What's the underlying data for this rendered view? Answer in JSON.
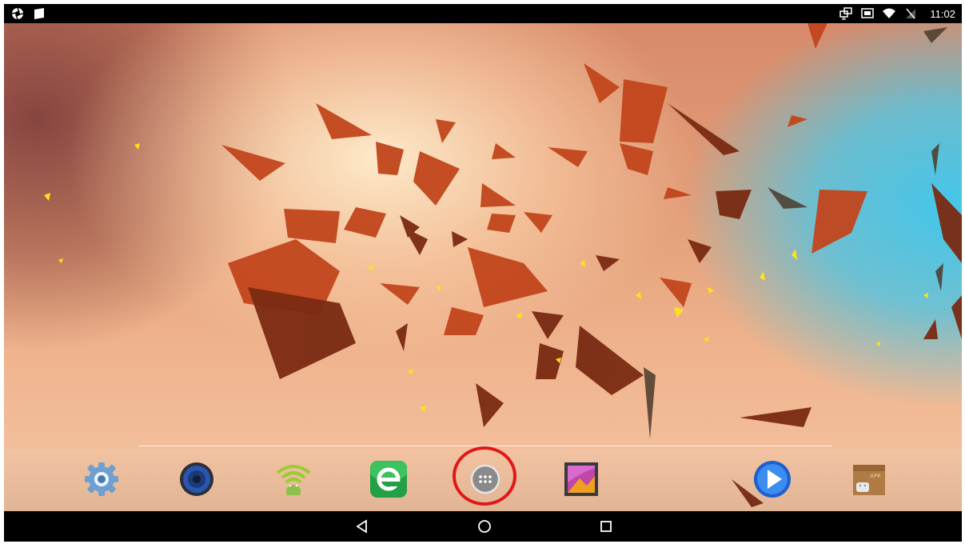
{
  "status_bar": {
    "left_icons": [
      "aperture-icon",
      "notification-card-icon"
    ],
    "right_icons": [
      "screen-mirror-icon",
      "cast-icon",
      "wifi-icon",
      "no-signal-icon"
    ],
    "time": "11:02"
  },
  "wallpaper": {
    "name": "abstract-shards-wallpaper"
  },
  "dock": {
    "apps": [
      {
        "name": "settings",
        "icon": "gear-icon"
      },
      {
        "name": "music",
        "icon": "speaker-icon"
      },
      {
        "name": "wifi-android",
        "icon": "android-wifi-icon"
      },
      {
        "name": "browser",
        "icon": "green-e-icon"
      },
      {
        "name": "all-apps",
        "icon": "app-drawer-icon",
        "highlighted": true,
        "highlight_color": "#e01818"
      },
      {
        "name": "gallery",
        "icon": "gallery-icon"
      },
      {
        "name": "media-player",
        "icon": "play-icon"
      },
      {
        "name": "apk-installer",
        "icon": "apk-box-icon",
        "badge": "APK"
      }
    ]
  },
  "nav_bar": {
    "buttons": [
      "back-icon",
      "home-icon",
      "recents-icon"
    ]
  },
  "colors": {
    "accent_highlight": "#e01818",
    "bar_background": "#000000"
  }
}
